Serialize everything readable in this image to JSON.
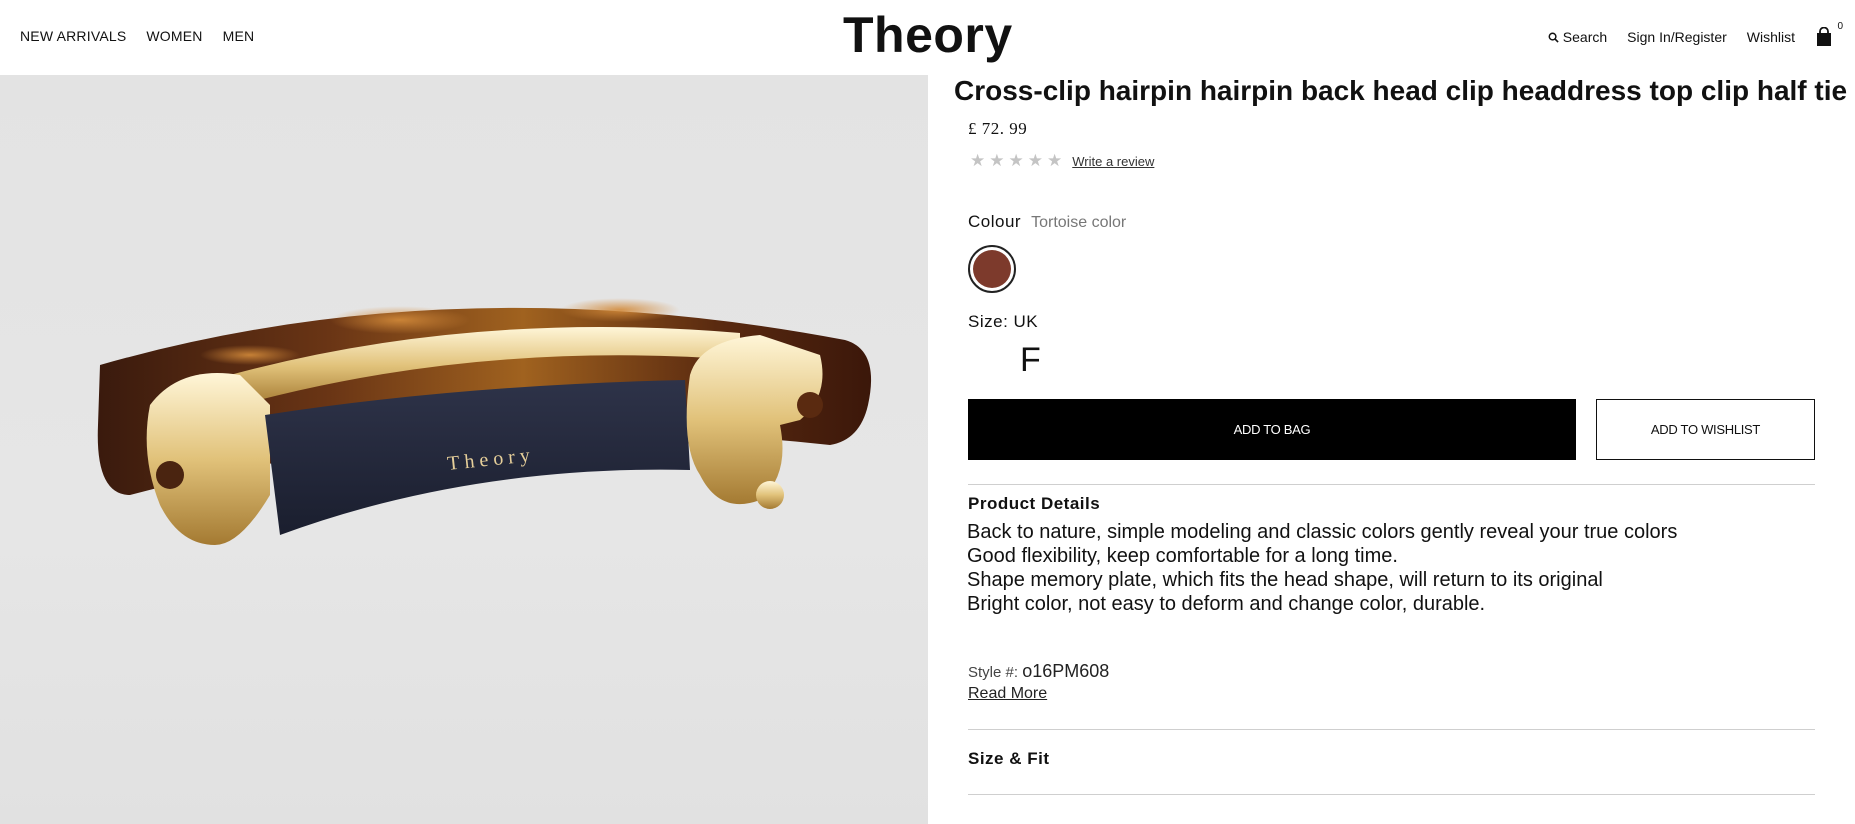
{
  "header": {
    "nav": [
      "NEW ARRIVALS",
      "WOMEN",
      "MEN"
    ],
    "logo": "Theory",
    "search_label": "Search",
    "signin_label": "Sign In/Register",
    "wishlist_label": "Wishlist",
    "bag_count": "0"
  },
  "product": {
    "title": "Cross-clip hairpin hairpin back head clip headdress top clip half tie",
    "price": "£ 72. 99",
    "rating": {
      "stars": 5,
      "filled": 0,
      "review_link": "Write a review"
    },
    "colour_label": "Colour",
    "colour_value": "Tortoise color",
    "swatch_color": "#7d3a2c",
    "size_label": "Size: UK",
    "size_option": "F",
    "add_to_bag": "ADD TO BAG",
    "add_to_wishlist": "ADD TO WISHLIST",
    "image_logo_text": "Theory"
  },
  "details": {
    "heading": "Product Details",
    "lines": [
      "Back to nature, simple modeling and classic colors gently reveal your true colors",
      "Good flexibility, keep comfortable for a long time.",
      "Shape memory plate, which fits the head shape, will return to its original",
      "Bright color, not easy to deform and change color, durable."
    ],
    "style_label": "Style #:",
    "style_value": "o16PM608",
    "read_more": "Read More"
  },
  "size_fit": {
    "heading": "Size & Fit"
  },
  "colors": {
    "black": "#000000",
    "swatch": "#7d3a2c",
    "star": "#c4c4c4"
  }
}
